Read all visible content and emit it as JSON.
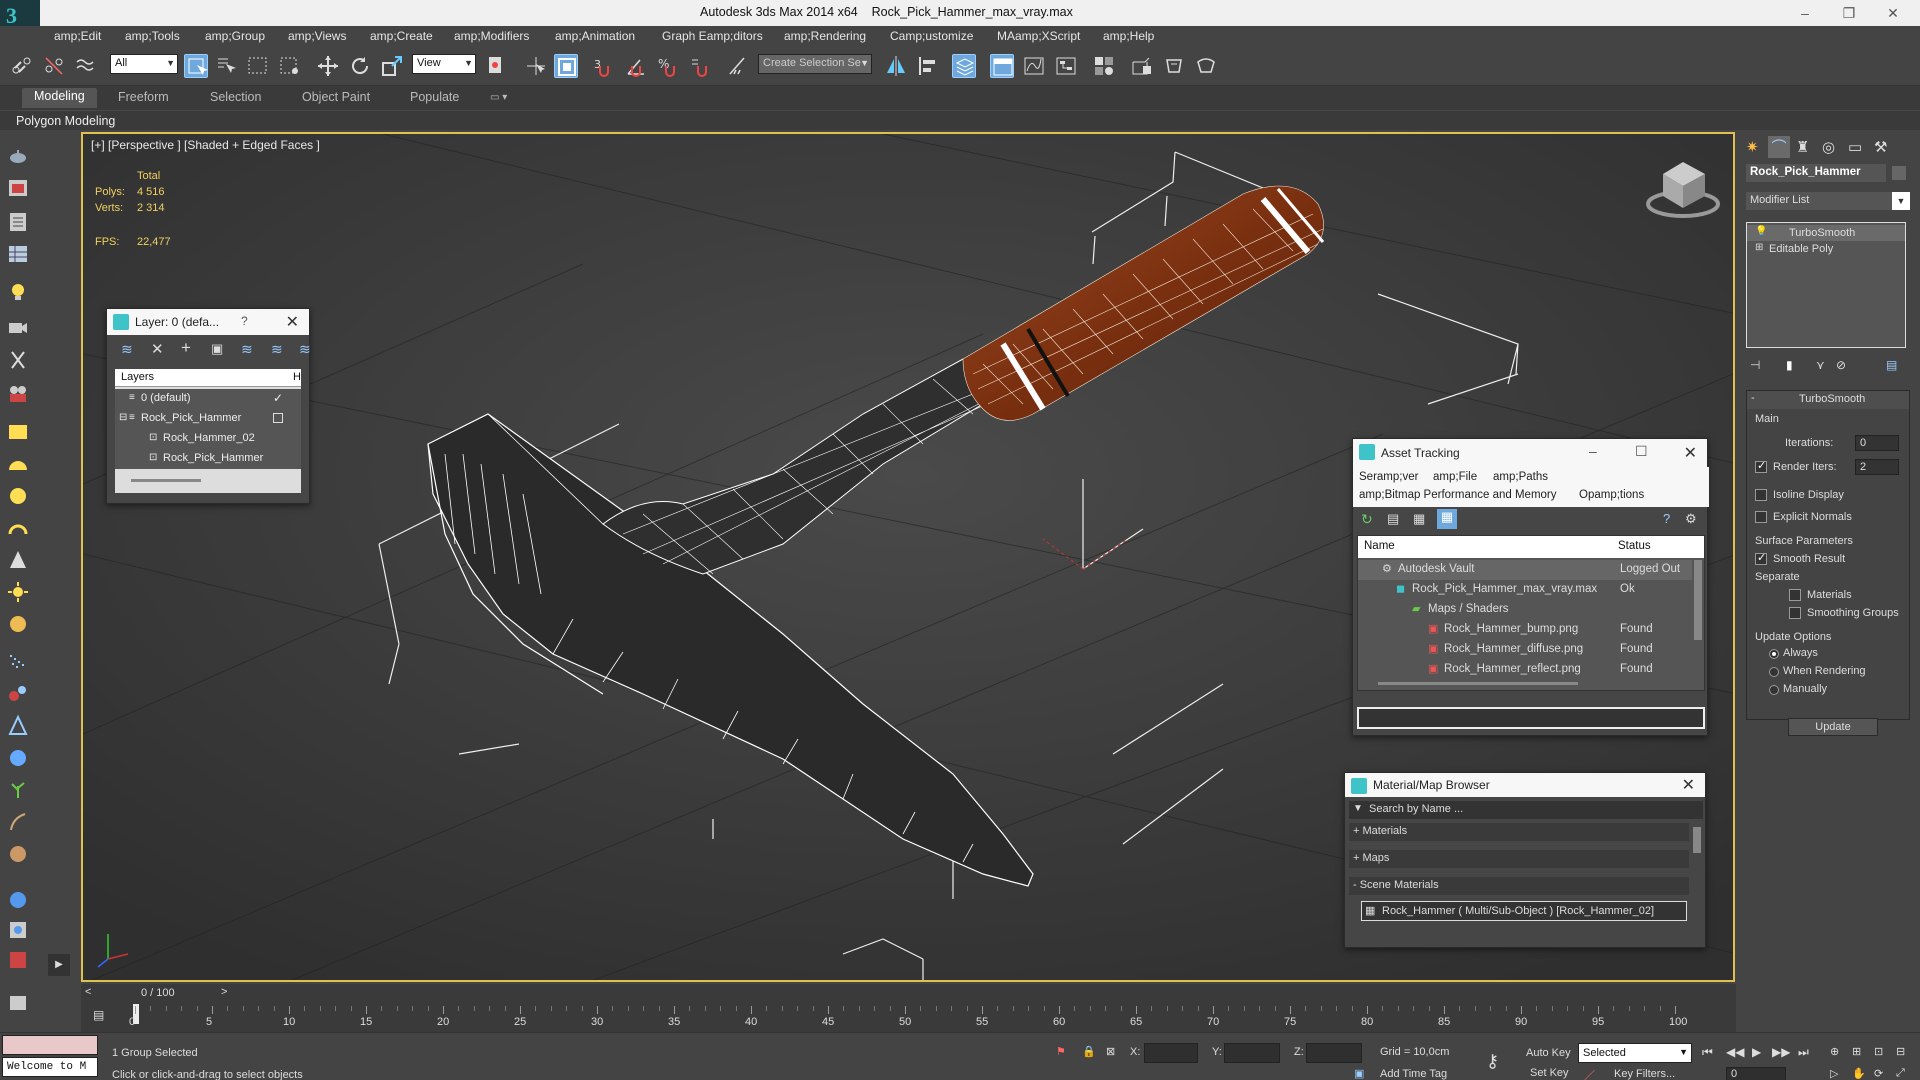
{
  "window": {
    "app_title": "Autodesk 3ds Max  2014 x64",
    "file_title": "Rock_Pick_Hammer_max_vray.max"
  },
  "menu": [
    "amp;Edit",
    "amp;Tools",
    "amp;Group",
    "amp;Views",
    "amp;Create",
    "amp;Modifiers",
    "amp;Animation",
    "Graph Eamp;ditors",
    "amp;Rendering",
    "Camp;ustomize",
    "MAamp;XScript",
    "amp;Help"
  ],
  "toolbar": {
    "filter_value": "All",
    "refcoord_value": "View",
    "selection_set_placeholder": "Create Selection Se"
  },
  "ribbon": {
    "tabs": [
      "Modeling",
      "Freeform",
      "Selection",
      "Object Paint",
      "Populate"
    ],
    "sub_label": "Polygon Modeling"
  },
  "viewport": {
    "label": "[+] [Perspective ] [Shaded + Edged Faces ]",
    "stats_total": "Total",
    "polys_label": "Polys:",
    "polys_value": "4 516",
    "verts_label": "Verts:",
    "verts_value": "2 314",
    "fps_label": "FPS:",
    "fps_value": "22,477"
  },
  "layer_panel": {
    "title": "Layer: 0 (defa...",
    "help": "?",
    "col_layers": "Layers",
    "col_h": "H",
    "rows": [
      "0 (default)",
      "Rock_Pick_Hammer",
      "Rock_Hammer_02",
      "Rock_Pick_Hammer"
    ]
  },
  "asset_tracking": {
    "title": "Asset Tracking",
    "menu": [
      "Seramp;ver",
      "amp;File",
      "amp;Paths",
      "amp;Bitmap Performance and Memory",
      "Opamp;tions"
    ],
    "col_name": "Name",
    "col_status": "Status",
    "rows": [
      {
        "name": "Autodesk Vault",
        "status": "Logged Out ..."
      },
      {
        "name": "Rock_Pick_Hammer_max_vray.max",
        "status": "Ok"
      },
      {
        "name": "Maps / Shaders",
        "status": ""
      },
      {
        "name": "Rock_Hammer_bump.png",
        "status": "Found"
      },
      {
        "name": "Rock_Hammer_diffuse.png",
        "status": "Found"
      },
      {
        "name": "Rock_Hammer_reflect.png",
        "status": "Found"
      }
    ]
  },
  "material_browser": {
    "title": "Material/Map Browser",
    "search_placeholder": "Search by Name ...",
    "sections": [
      "+ Materials",
      "+ Maps",
      "- Scene Materials"
    ],
    "scene_material": "Rock_Hammer  ( Multi/Sub-Object ) [Rock_Hammer_02]"
  },
  "command_panel": {
    "object_name": "Rock_Pick_Hammer",
    "modifier_list": "Modifier List",
    "stack": [
      "TurboSmooth",
      "Editable Poly"
    ],
    "rollout_title": "TurboSmooth",
    "main_label": "Main",
    "iterations_label": "Iterations:",
    "iterations_value": "0",
    "render_iters_label": "Render Iters:",
    "render_iters_value": "2",
    "isoline": "Isoline Display",
    "explicit_normals": "Explicit Normals",
    "surface_params": "Surface Parameters",
    "smooth_result": "Smooth Result",
    "separate": "Separate",
    "materials": "Materials",
    "smoothing_groups": "Smoothing Groups",
    "update_options": "Update Options",
    "always": "Always",
    "when_rendering": "When Rendering",
    "manually": "Manually",
    "update_button": "Update"
  },
  "timeline": {
    "frame": "0 / 100",
    "ticks": [
      "0",
      "5",
      "10",
      "15",
      "20",
      "25",
      "30",
      "35",
      "40",
      "45",
      "50",
      "55",
      "60",
      "65",
      "70",
      "75",
      "80",
      "85",
      "90",
      "95",
      "100"
    ]
  },
  "status": {
    "maxscript": "Welcome to M",
    "selection": "1 Group Selected",
    "prompt": "Click or click-and-drag to select objects",
    "x_label": "X:",
    "y_label": "Y:",
    "z_label": "Z:",
    "grid": "Grid = 10,0cm",
    "add_time_tag": "Add Time Tag",
    "auto_key": "Auto Key",
    "set_key": "Set Key",
    "key_mode": "Selected",
    "key_filters": "Key Filters...",
    "frame_value": "0"
  },
  "colors": {
    "handle_wood": "#8a3a1a",
    "viewport_border": "#e0c050",
    "stats_yellow": "#f0d060"
  }
}
